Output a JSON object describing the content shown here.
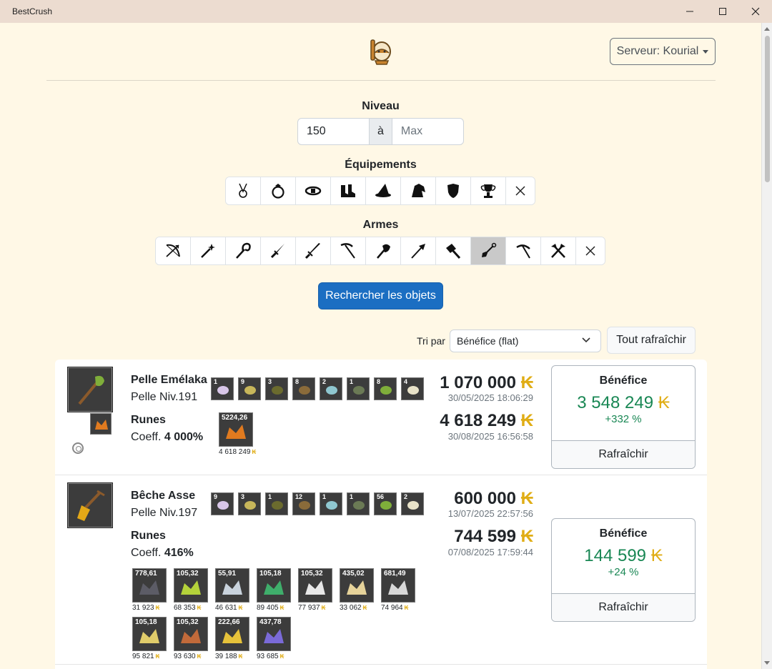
{
  "window": {
    "title": "BestCrush"
  },
  "header": {
    "server_label": "Serveur: Kourial"
  },
  "filters": {
    "level_label": "Niveau",
    "level_min": "150",
    "level_sep": "à",
    "level_max_placeholder": "Max",
    "equip_label": "Équipements",
    "equipment": [
      "amulet-icon",
      "ring-icon",
      "belt-icon",
      "boots-icon",
      "hat-icon",
      "cloak-icon",
      "shield-icon",
      "trophy-icon",
      "clear-icon"
    ],
    "weapons_label": "Armes",
    "weapons": [
      "bow-icon",
      "wand-icon",
      "staff-icon",
      "dagger-icon",
      "sword-icon",
      "scythe-icon",
      "axe-icon",
      "spear-icon",
      "hammer-icon",
      "shovel-icon",
      "pickaxe-icon",
      "tools-icon",
      "clear-icon"
    ],
    "active_weapon": "shovel-icon",
    "search_label": "Rechercher les objets"
  },
  "sort": {
    "label": "Tri par",
    "selected": "Bénéfice (flat)",
    "refresh_all": "Tout rafraîchir"
  },
  "kama_symbol": "₭",
  "items": [
    {
      "name": "Pelle Emélaka",
      "type_level": "Pelle Niv.191",
      "runes_label": "Runes",
      "coeff_prefix": "Coeff.",
      "coeff": "4 000%",
      "stats": [
        "1",
        "9",
        "3",
        "8",
        "2",
        "1",
        "8",
        "4"
      ],
      "runes": [
        {
          "qty": "5224,26",
          "price": "4 618 249"
        }
      ],
      "buy_price": "1 070 000",
      "buy_date": "30/05/2025 18:06:29",
      "sell_price": "4 618 249",
      "sell_date": "30/08/2025 16:56:58",
      "benefit_label": "Bénéfice",
      "benefit": "3 548 249",
      "benefit_pct": "+332 %",
      "refresh": "Rafraîchir"
    },
    {
      "name": "Bêche Asse",
      "type_level": "Pelle Niv.197",
      "runes_label": "Runes",
      "coeff_prefix": "Coeff.",
      "coeff": "416%",
      "stats": [
        "9",
        "3",
        "1",
        "12",
        "1",
        "1",
        "56",
        "2"
      ],
      "runes": [
        {
          "qty": "778,61",
          "price": "31 923"
        },
        {
          "qty": "105,32",
          "price": "68 353"
        },
        {
          "qty": "55,91",
          "price": "46 631"
        },
        {
          "qty": "105,18",
          "price": "89 405"
        },
        {
          "qty": "105,32",
          "price": "77 937"
        },
        {
          "qty": "435,02",
          "price": "33 062"
        },
        {
          "qty": "681,49",
          "price": "74 964"
        },
        {
          "qty": "105,18",
          "price": "95 821"
        },
        {
          "qty": "105,32",
          "price": "93 630"
        },
        {
          "qty": "222,66",
          "price": "39 188"
        },
        {
          "qty": "437,78",
          "price": "93 685"
        }
      ],
      "buy_price": "600 000",
      "buy_date": "13/07/2025 22:57:56",
      "sell_price": "744 599",
      "sell_date": "07/08/2025 17:59:44",
      "benefit_label": "Bénéfice",
      "benefit": "144 599",
      "benefit_pct": "+24 %",
      "refresh": "Rafraîchir"
    }
  ],
  "colors": {
    "accent": "#1b6ec2",
    "positive": "#198754",
    "kama": "#e0ad15",
    "background": "#fff8e6"
  }
}
